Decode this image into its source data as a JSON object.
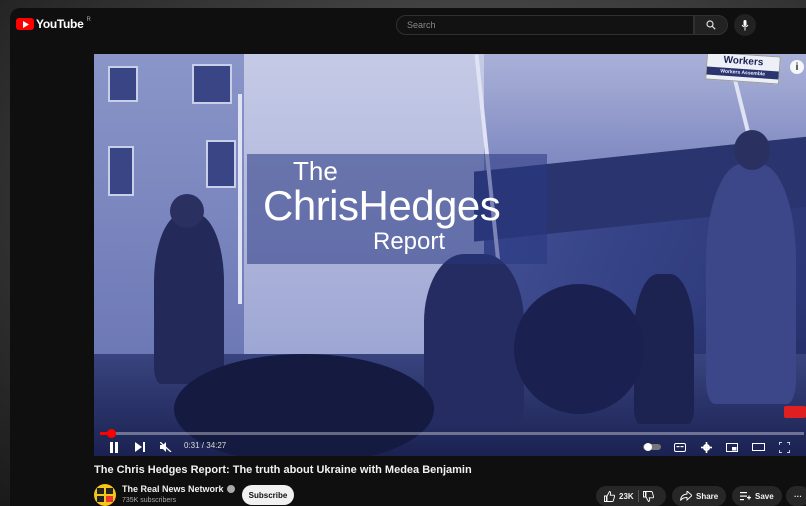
{
  "header": {
    "logo_text": "YouTube",
    "region": "R",
    "search_placeholder": "Search"
  },
  "video": {
    "title_card": {
      "line1": "The",
      "line2": "ChrisHedges",
      "line3": "Report"
    },
    "sign_text": "Workers",
    "sign_subtext": "Workers Assemble",
    "progress": 0.015,
    "time": "0:31 / 34:27"
  },
  "meta": {
    "title": "The Chris Hedges Report: The truth about Ukraine with Medea Benjamin",
    "channel_name": "The Real News Network",
    "subscribers": "735K subscribers",
    "subscribe_label": "Subscribe",
    "likes": "23K",
    "share_label": "Share",
    "save_label": "Save",
    "more_label": "···"
  },
  "colors": {
    "accent": "#ff0000",
    "bg": "#0f0f0f",
    "pill": "#272727"
  }
}
